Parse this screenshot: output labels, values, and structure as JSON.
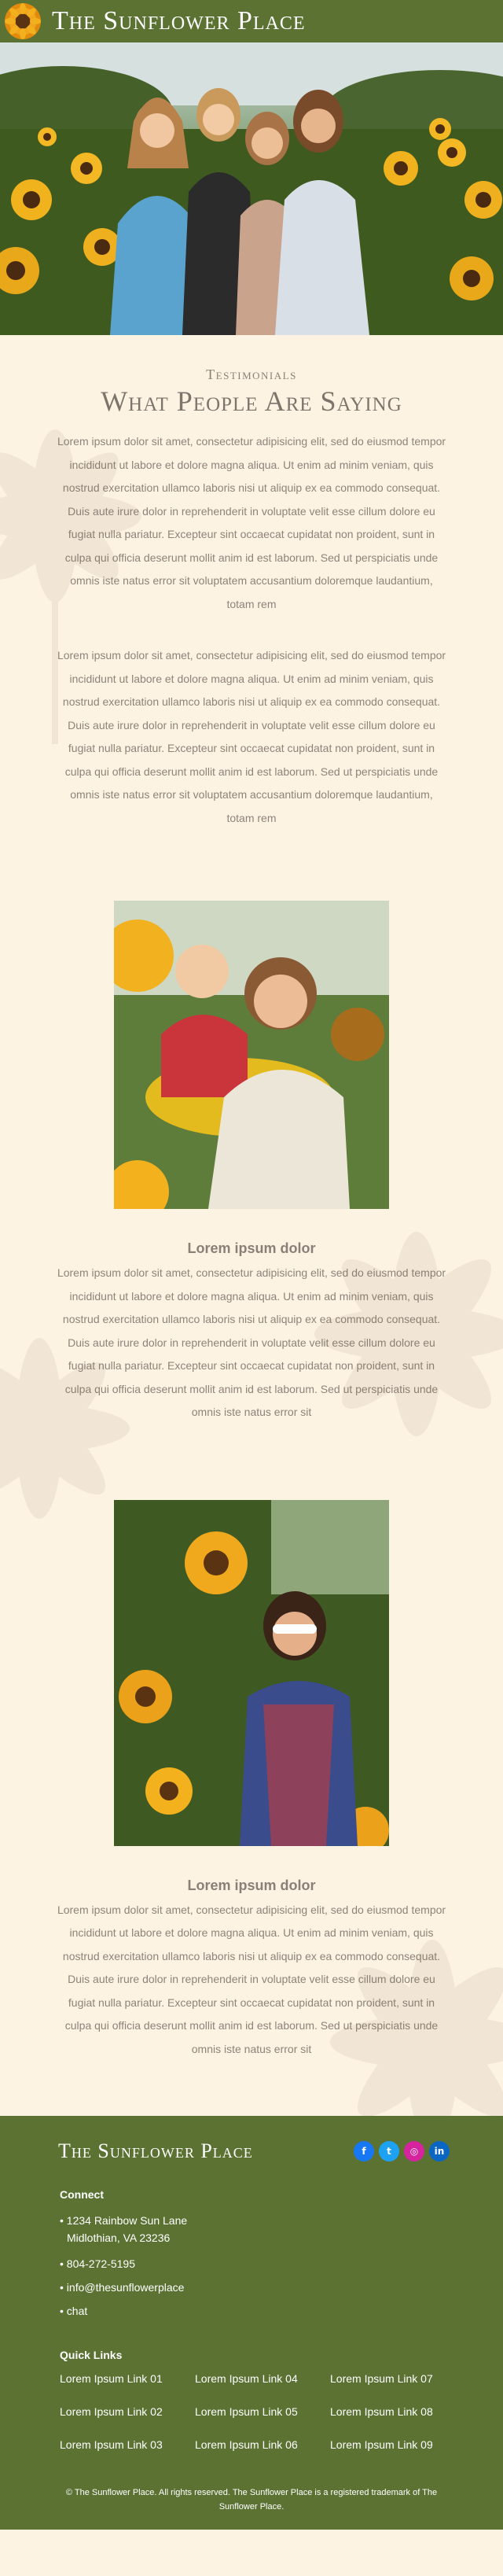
{
  "header": {
    "brand": "The Sunflower Place",
    "logo_icon": "sunflower-logo-icon"
  },
  "hero": {
    "alt_subject": "hero-photo"
  },
  "testimonials": {
    "eyebrow": "Testimonials",
    "title": "What People Are Saying",
    "paragraph_1": "Lorem ipsum dolor sit amet, consectetur adipisicing elit, sed do eiusmod tempor incididunt ut labore et dolore magna aliqua. Ut enim ad minim veniam, quis nostrud exercitation ullamco laboris nisi ut aliquip ex ea commodo consequat. Duis aute irure dolor in reprehenderit in voluptate velit esse cillum dolore eu fugiat nulla pariatur. Excepteur sint occaecat cupidatat non proident, sunt in culpa qui officia deserunt mollit anim id est laborum. Sed ut perspiciatis unde omnis iste natus error sit voluptatem accusantium doloremque laudantium, totam rem",
    "paragraph_2": "Lorem ipsum dolor sit amet, consectetur adipisicing elit, sed do eiusmod tempor incididunt ut labore et dolore magna aliqua. Ut enim ad minim veniam, quis nostrud exercitation ullamco laboris nisi ut aliquip ex ea commodo consequat. Duis aute irure dolor in reprehenderit in voluptate velit esse cillum dolore eu fugiat nulla pariatur. Excepteur sint occaecat cupidatat non proident, sunt in culpa qui officia deserunt mollit anim id est laborum. Sed ut perspiciatis unde omnis iste natus error sit voluptatem accusantium doloremque laudantium, totam rem"
  },
  "cards": [
    {
      "title": "Lorem ipsum dolor",
      "text": "Lorem ipsum dolor sit amet, consectetur adipisicing elit, sed do eiusmod tempor incididunt ut labore et dolore magna aliqua. Ut enim ad minim veniam, quis nostrud exercitation ullamco laboris nisi ut aliquip ex ea commodo consequat. Duis aute irure dolor in reprehenderit in voluptate velit esse cillum dolore eu fugiat nulla pariatur. Excepteur sint occaecat cupidatat non proident, sunt in culpa qui officia deserunt mollit anim id est laborum. Sed ut perspiciatis unde omnis iste natus error sit"
    },
    {
      "title": "Lorem ipsum dolor",
      "text": "Lorem ipsum dolor sit amet, consectetur adipisicing elit, sed do eiusmod tempor incididunt ut labore et dolore magna aliqua. Ut enim ad minim veniam, quis nostrud exercitation ullamco laboris nisi ut aliquip ex ea commodo consequat. Duis aute irure dolor in reprehenderit in voluptate velit esse cillum dolore eu fugiat nulla pariatur. Excepteur sint occaecat cupidatat non proident, sunt in culpa qui officia deserunt mollit anim id est laborum. Sed ut perspiciatis unde omnis iste natus error sit"
    }
  ],
  "footer": {
    "brand": "The Sunflower Place",
    "socials": [
      {
        "icon": "facebook-icon",
        "glyph": "f",
        "color": "#1877f2"
      },
      {
        "icon": "twitter-icon",
        "glyph": "t",
        "color": "#1da1f2"
      },
      {
        "icon": "instagram-icon",
        "glyph": "◎",
        "color": "#d6249f"
      },
      {
        "icon": "linkedin-icon",
        "glyph": "in",
        "color": "#0a66c2"
      }
    ],
    "connect_heading": "Connect",
    "address_line_1": "• 1234 Rainbow Sun Lane",
    "address_line_2": "Midlothian, VA 23236",
    "phone": "• 804-272-5195",
    "email": "• info@thesunflowerplace",
    "chat": "• chat",
    "quick_links_heading": "Quick Links",
    "quick_links": [
      "Lorem Ipsum Link 01",
      "Lorem Ipsum Link 04",
      "Lorem Ipsum Link 07",
      "Lorem Ipsum Link 02",
      "Lorem Ipsum Link 05",
      "Lorem Ipsum Link 08",
      "Lorem Ipsum Link 03",
      "Lorem Ipsum Link 06",
      "Lorem Ipsum Link 09"
    ],
    "copyright": "© The Sunflower Place. All rights reserved. The Sunflower Place is a registered trademark of The Sunflower Place."
  },
  "colors": {
    "header_green": "#5b7233",
    "page_cream": "#fdf3e3",
    "text_gray": "#8a8077"
  }
}
